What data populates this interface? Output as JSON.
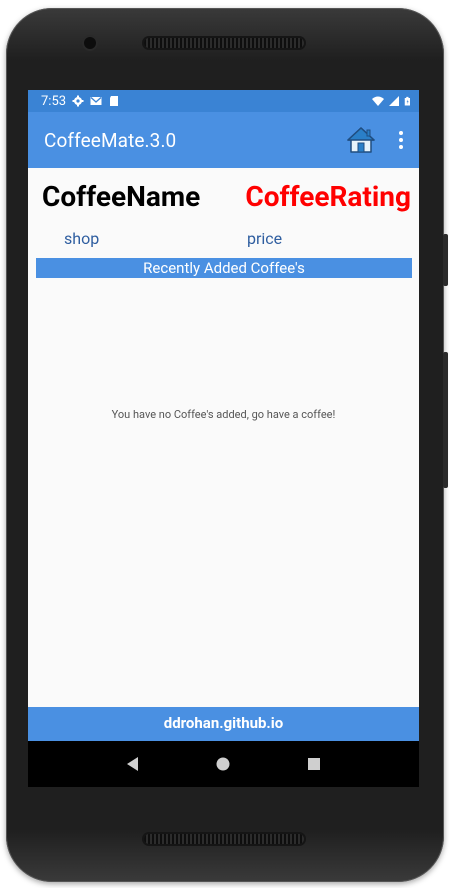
{
  "status_bar": {
    "time": "7:53",
    "left_icons": [
      "gear-icon",
      "gmail-icon",
      "sd-card-icon"
    ],
    "right_icons": [
      "wifi-icon",
      "signal-icon",
      "battery-icon"
    ]
  },
  "app_bar": {
    "title": "CoffeeMate.3.0",
    "actions": [
      "home-icon",
      "overflow-menu-icon"
    ]
  },
  "favourite": {
    "name": "CoffeeName",
    "rating": "CoffeeRating",
    "shop": "shop",
    "price": "price"
  },
  "list_header": "Recently Added Coffee's",
  "empty_message": "You have no Coffee's added, go have a coffee!",
  "footer": "ddrohan.github.io",
  "nav_bar": [
    "back-icon",
    "home-circle-icon",
    "recents-icon"
  ],
  "colors": {
    "primary": "#4a90e2",
    "status_bar": "#3a83d4",
    "rating": "#ff0000",
    "secondary_text": "#2f5ea0"
  }
}
